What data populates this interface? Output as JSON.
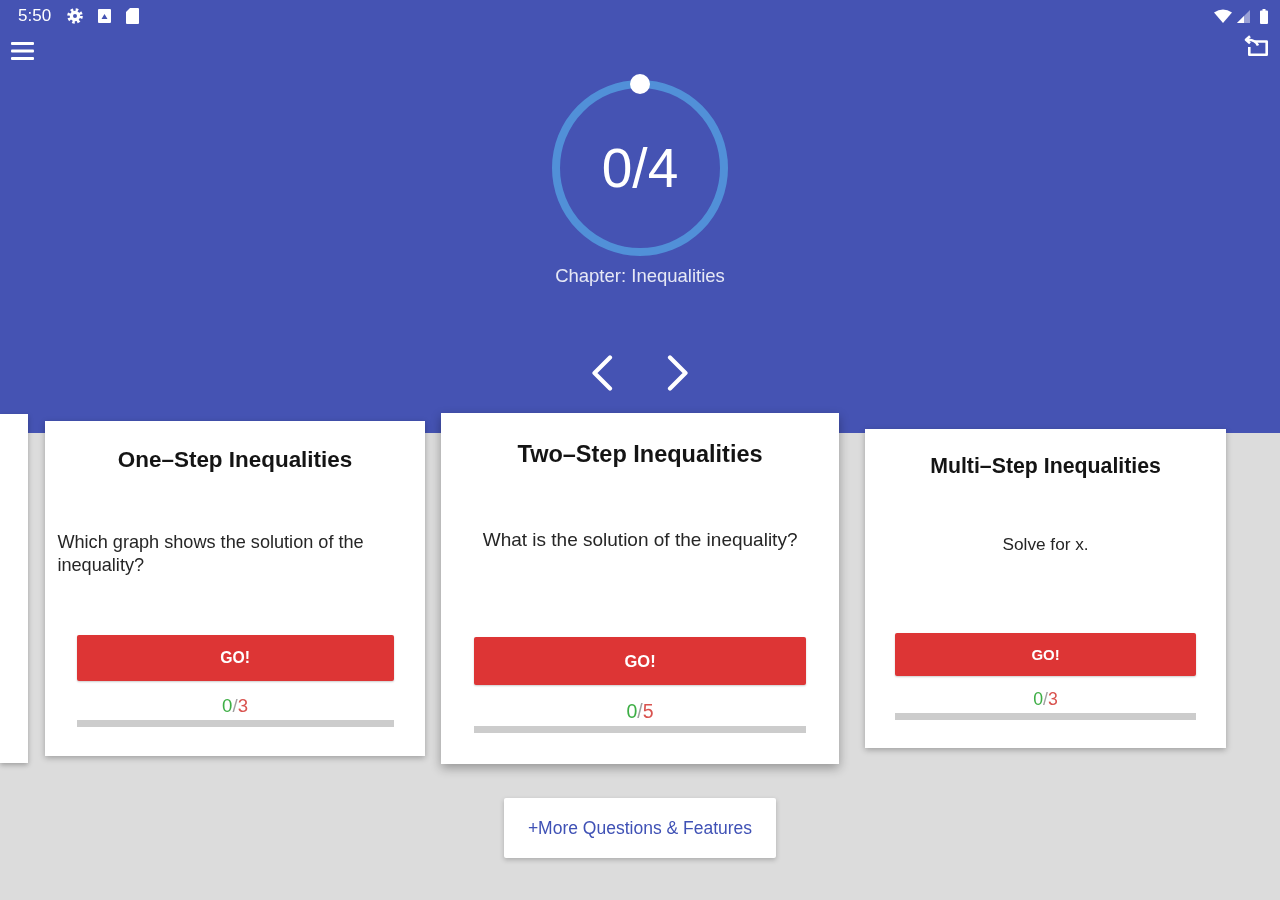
{
  "status_bar": {
    "time": "5:50"
  },
  "progress": {
    "value": "0/4",
    "chapter": "Chapter: Inequalities"
  },
  "cards": [
    {
      "title": "One–Step Inequalities",
      "question": "Which graph shows the solution of the inequality?",
      "button": "GO!",
      "score": {
        "correct": "0",
        "separator": "/",
        "total": "3"
      }
    },
    {
      "title": "Two–Step Inequalities",
      "question": "What is the solution of the inequality?",
      "button": "GO!",
      "score": {
        "correct": "0",
        "separator": "/",
        "total": "5"
      }
    },
    {
      "title": "Multi–Step Inequalities",
      "question": "Solve for x.",
      "button": "GO!",
      "score": {
        "correct": "0",
        "separator": "/",
        "total": "3"
      }
    }
  ],
  "more_button": "+More Questions & Features"
}
